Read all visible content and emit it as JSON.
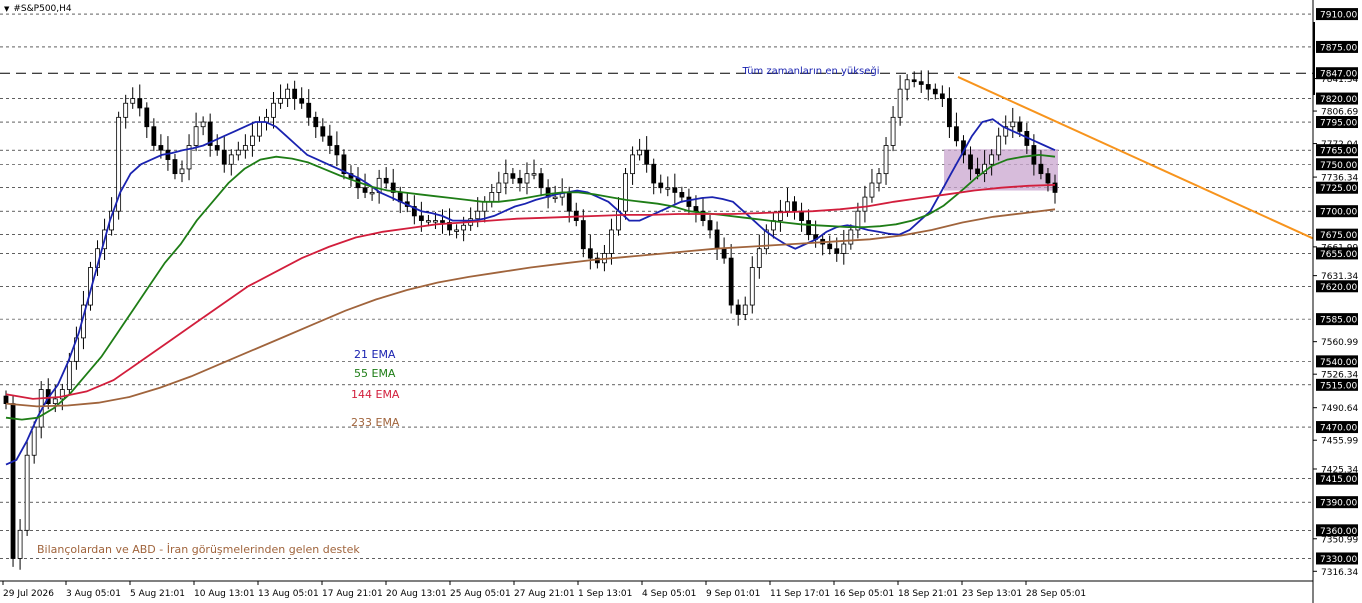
{
  "header": {
    "symbol": "#S&P500,H4"
  },
  "colors": {
    "ema21": "#1a23b0",
    "ema55": "#1e7d16",
    "ema144": "#d21e3c",
    "ema233": "#a0643c",
    "trendline": "#f7941d",
    "zone": "#c9a6cf",
    "candle": "#000000",
    "grid": "#000000",
    "price_badge": "#000000",
    "note": "#a0643c",
    "ath_label": "#1a23b0"
  },
  "annotations": {
    "ath": "Tüm zamanların en yükseği",
    "note": "Bilançolardan ve ABD - İran görüşmelerinden gelen destek",
    "ema21": "21 EMA",
    "ema55": "55 EMA",
    "ema144": "144 EMA",
    "ema233": "233 EMA"
  },
  "chart_data": {
    "type": "candlestick",
    "symbol": "#S&P500",
    "timeframe": "H4",
    "ylim": [
      7306,
      7925
    ],
    "x_tick_labels": [
      "29 Jul 2026",
      "3 Aug 05:01",
      "5 Aug 21:01",
      "10 Aug 13:01",
      "13 Aug 05:01",
      "17 Aug 21:01",
      "20 Aug 13:01",
      "25 Aug 05:01",
      "27 Aug 21:01",
      "1 Sep 13:01",
      "4 Sep 05:01",
      "9 Sep 01:01",
      "11 Sep 17:01",
      "16 Sep 05:01",
      "18 Sep 21:01",
      "23 Sep 13:01",
      "28 Sep 05:01"
    ],
    "highlighted_levels": [
      7910.0,
      7875.0,
      7847.0,
      7820.0,
      7795.0,
      7765.0,
      7750.0,
      7725.0,
      7700.0,
      7675.0,
      7655.0,
      7620.0,
      7585.0,
      7540.0,
      7515.0,
      7470.0,
      7415.0,
      7390.0,
      7360.0,
      7330.0
    ],
    "scale_levels": [
      7841.34,
      7806.69,
      7772.04,
      7736.34,
      7661.99,
      7631.34,
      7560.99,
      7526.34,
      7490.64,
      7455.99,
      7425.34,
      7350.99,
      7316.34
    ],
    "all_time_high_level": 7847.0,
    "closes": [
      7495,
      7330,
      7360,
      7440,
      7470,
      7510,
      7495,
      7500,
      7510,
      7540,
      7565,
      7600,
      7640,
      7660,
      7680,
      7700,
      7800,
      7815,
      7820,
      7810,
      7790,
      7770,
      7765,
      7755,
      7740,
      7745,
      7770,
      7790,
      7795,
      7770,
      7765,
      7750,
      7760,
      7765,
      7770,
      7780,
      7795,
      7800,
      7815,
      7820,
      7830,
      7820,
      7815,
      7800,
      7790,
      7780,
      7770,
      7760,
      7740,
      7735,
      7725,
      7720,
      7720,
      7735,
      7730,
      7720,
      7710,
      7705,
      7695,
      7690,
      7690,
      7690,
      7688,
      7680,
      7680,
      7685,
      7692,
      7700,
      7710,
      7720,
      7730,
      7740,
      7735,
      7730,
      7740,
      7740,
      7725,
      7715,
      7715,
      7720,
      7700,
      7690,
      7660,
      7650,
      7645,
      7655,
      7680,
      7700,
      7740,
      7760,
      7765,
      7750,
      7730,
      7725,
      7725,
      7720,
      7715,
      7705,
      7700,
      7690,
      7680,
      7660,
      7650,
      7600,
      7590,
      7600,
      7640,
      7660,
      7680,
      7690,
      7700,
      7710,
      7700,
      7690,
      7675,
      7670,
      7665,
      7660,
      7655,
      7665,
      7680,
      7700,
      7715,
      7730,
      7740,
      7770,
      7800,
      7830,
      7840,
      7838,
      7835,
      7830,
      7825,
      7820,
      7790,
      7775,
      7760,
      7745,
      7740,
      7750,
      7760,
      7780,
      7790,
      7795,
      7785,
      7770,
      7750,
      7740,
      7730,
      7720
    ],
    "series": [
      {
        "name": "21 EMA",
        "values": [
          7430,
          7435,
          7455,
          7480,
          7500,
          7515,
          7540,
          7570,
          7610,
          7650,
          7690,
          7720,
          7740,
          7750,
          7755,
          7760,
          7762,
          7765,
          7767,
          7770,
          7775,
          7780,
          7785,
          7790,
          7795,
          7795,
          7790,
          7780,
          7770,
          7760,
          7755,
          7750,
          7745,
          7740,
          7735,
          7728,
          7720,
          7715,
          7710,
          7705,
          7700,
          7698,
          7695,
          7690,
          7690,
          7690,
          7692,
          7695,
          7700,
          7705,
          7708,
          7712,
          7715,
          7718,
          7720,
          7722,
          7720,
          7715,
          7710,
          7700,
          7690,
          7690,
          7695,
          7700,
          7705,
          7710,
          7712,
          7714,
          7715,
          7713,
          7710,
          7700,
          7690,
          7680,
          7672,
          7665,
          7660,
          7665,
          7670,
          7678,
          7683,
          7685,
          7683,
          7680,
          7678,
          7676,
          7675,
          7680,
          7690,
          7700,
          7720,
          7740,
          7760,
          7780,
          7795,
          7798,
          7790,
          7785,
          7780,
          7775,
          7770,
          7765
        ]
      },
      {
        "name": "55 EMA",
        "values": [
          7480,
          7478,
          7480,
          7490,
          7505,
          7525,
          7545,
          7570,
          7595,
          7620,
          7645,
          7665,
          7690,
          7710,
          7730,
          7745,
          7755,
          7758,
          7756,
          7752,
          7745,
          7738,
          7732,
          7726,
          7722,
          7720,
          7718,
          7716,
          7714,
          7712,
          7710,
          7710,
          7712,
          7715,
          7718,
          7720,
          7720,
          7718,
          7715,
          7712,
          7710,
          7708,
          7705,
          7700,
          7698,
          7696,
          7694,
          7692,
          7690,
          7688,
          7686,
          7685,
          7684,
          7683,
          7683,
          7684,
          7686,
          7690,
          7696,
          7706,
          7720,
          7735,
          7748,
          7755,
          7758,
          7760,
          7758
        ]
      },
      {
        "name": "144 EMA",
        "values": [
          7505,
          7500,
          7502,
          7508,
          7520,
          7540,
          7560,
          7580,
          7600,
          7620,
          7635,
          7650,
          7662,
          7672,
          7678,
          7682,
          7686,
          7688,
          7690,
          7692,
          7693,
          7694,
          7695,
          7696,
          7696,
          7697,
          7697,
          7697,
          7698,
          7699,
          7700,
          7702,
          7705,
          7710,
          7714,
          7718,
          7722,
          7725,
          7727,
          7728
        ]
      },
      {
        "name": "233 EMA",
        "values": [
          7495,
          7492,
          7493,
          7496,
          7502,
          7512,
          7524,
          7538,
          7552,
          7566,
          7580,
          7594,
          7606,
          7616,
          7624,
          7630,
          7635,
          7640,
          7644,
          7648,
          7651,
          7654,
          7657,
          7660,
          7662,
          7664,
          7666,
          7668,
          7670,
          7674,
          7680,
          7688,
          7694,
          7698,
          7702
        ]
      }
    ]
  }
}
